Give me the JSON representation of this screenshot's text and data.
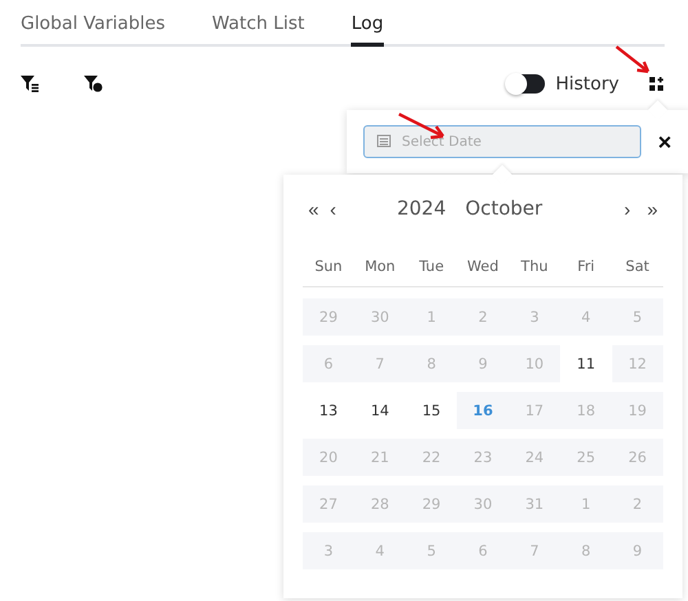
{
  "tabs": [
    {
      "label": "Global Variables",
      "selected": false
    },
    {
      "label": "Watch List",
      "selected": false
    },
    {
      "label": "Log",
      "selected": true
    }
  ],
  "toolbar": {
    "history": {
      "label": "History",
      "on": false
    }
  },
  "date_picker": {
    "placeholder": "Select Date",
    "close": "×",
    "header": {
      "prev_year": "«",
      "prev_month": "‹",
      "year": "2024",
      "month": "October",
      "next_month": "›",
      "next_year": "»"
    },
    "weekdays": [
      "Sun",
      "Mon",
      "Tue",
      "Wed",
      "Thu",
      "Fri",
      "Sat"
    ],
    "weeks": [
      [
        {
          "day": "29",
          "disabled": true,
          "today": false
        },
        {
          "day": "30",
          "disabled": true,
          "today": false
        },
        {
          "day": "1",
          "disabled": true,
          "today": false
        },
        {
          "day": "2",
          "disabled": true,
          "today": false
        },
        {
          "day": "3",
          "disabled": true,
          "today": false
        },
        {
          "day": "4",
          "disabled": true,
          "today": false
        },
        {
          "day": "5",
          "disabled": true,
          "today": false
        }
      ],
      [
        {
          "day": "6",
          "disabled": true,
          "today": false
        },
        {
          "day": "7",
          "disabled": true,
          "today": false
        },
        {
          "day": "8",
          "disabled": true,
          "today": false
        },
        {
          "day": "9",
          "disabled": true,
          "today": false
        },
        {
          "day": "10",
          "disabled": true,
          "today": false
        },
        {
          "day": "11",
          "disabled": false,
          "today": false
        },
        {
          "day": "12",
          "disabled": true,
          "today": false
        }
      ],
      [
        {
          "day": "13",
          "disabled": false,
          "today": false
        },
        {
          "day": "14",
          "disabled": false,
          "today": false
        },
        {
          "day": "15",
          "disabled": false,
          "today": false
        },
        {
          "day": "16",
          "disabled": true,
          "today": true
        },
        {
          "day": "17",
          "disabled": true,
          "today": false
        },
        {
          "day": "18",
          "disabled": true,
          "today": false
        },
        {
          "day": "19",
          "disabled": true,
          "today": false
        }
      ],
      [
        {
          "day": "20",
          "disabled": true,
          "today": false
        },
        {
          "day": "21",
          "disabled": true,
          "today": false
        },
        {
          "day": "22",
          "disabled": true,
          "today": false
        },
        {
          "day": "23",
          "disabled": true,
          "today": false
        },
        {
          "day": "24",
          "disabled": true,
          "today": false
        },
        {
          "day": "25",
          "disabled": true,
          "today": false
        },
        {
          "day": "26",
          "disabled": true,
          "today": false
        }
      ],
      [
        {
          "day": "27",
          "disabled": true,
          "today": false
        },
        {
          "day": "28",
          "disabled": true,
          "today": false
        },
        {
          "day": "29",
          "disabled": true,
          "today": false
        },
        {
          "day": "30",
          "disabled": true,
          "today": false
        },
        {
          "day": "31",
          "disabled": true,
          "today": false
        },
        {
          "day": "1",
          "disabled": true,
          "today": false
        },
        {
          "day": "2",
          "disabled": true,
          "today": false
        }
      ],
      [
        {
          "day": "3",
          "disabled": true,
          "today": false
        },
        {
          "day": "4",
          "disabled": true,
          "today": false
        },
        {
          "day": "5",
          "disabled": true,
          "today": false
        },
        {
          "day": "6",
          "disabled": true,
          "today": false
        },
        {
          "day": "7",
          "disabled": true,
          "today": false
        },
        {
          "day": "8",
          "disabled": true,
          "today": false
        },
        {
          "day": "9",
          "disabled": true,
          "today": false
        }
      ]
    ]
  }
}
